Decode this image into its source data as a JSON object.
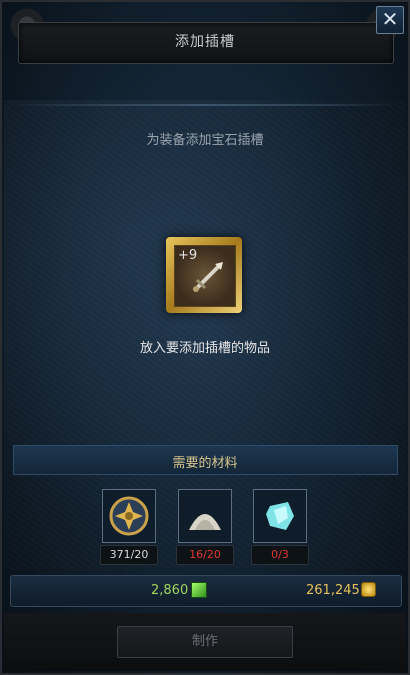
{
  "window": {
    "title": "添加插槽",
    "close_label": "✕"
  },
  "instructions": {
    "subtitle": "为装备添加宝石插槽",
    "item_slot_label": "放入要添加插槽的物品",
    "item_enchant_level": "+9"
  },
  "materials": {
    "header": "需要的材料",
    "items": [
      {
        "icon": "gold-medallion-icon",
        "count": "371/20",
        "count_color": "#d8d8d8"
      },
      {
        "icon": "white-powder-icon",
        "count": "16/20",
        "count_color": "#e0382f"
      },
      {
        "icon": "crystal-icon",
        "count": "0/3",
        "count_color": "#e0382f"
      }
    ]
  },
  "currency": {
    "green_amount": "2,860",
    "gold_amount": "261,245"
  },
  "actions": {
    "craft_label": "制作"
  }
}
